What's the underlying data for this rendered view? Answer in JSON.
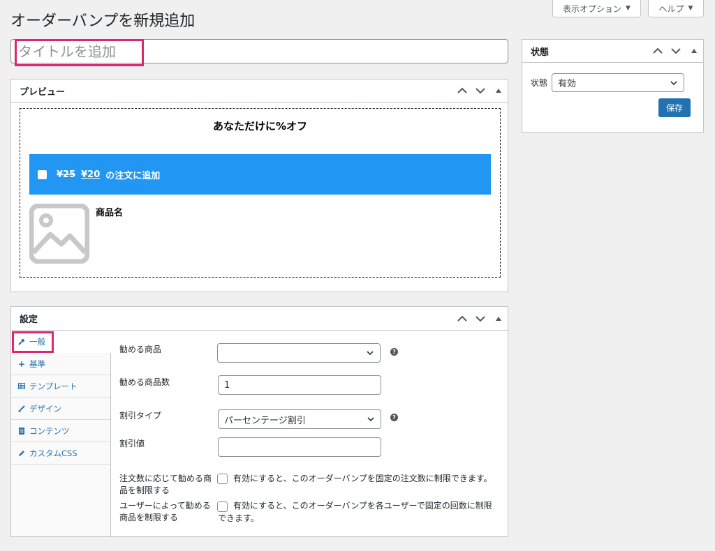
{
  "header": {
    "title": "オーダーバンプを新規追加",
    "screen_options_label": "表示オプション",
    "help_label": "ヘルプ"
  },
  "title_field": {
    "placeholder": "タイトルを追加",
    "value": ""
  },
  "status_box": {
    "title": "状態",
    "status_label": "状態",
    "status_value": "有効",
    "save_label": "保存"
  },
  "preview_box": {
    "title": "プレビュー",
    "headline": "あなただけに%オフ",
    "old_price": "¥25",
    "new_price": "¥20",
    "add_text": "の注文に追加",
    "product_name": "商品名",
    "bar_color": "#2196f3"
  },
  "settings_box": {
    "title": "設定",
    "tabs": [
      {
        "label": "一般",
        "icon": "wrench-icon"
      },
      {
        "label": "基準",
        "icon": "plus-icon"
      },
      {
        "label": "テンプレート",
        "icon": "table-icon"
      },
      {
        "label": "デザイン",
        "icon": "brush-icon"
      },
      {
        "label": "コンテンツ",
        "icon": "document-icon"
      },
      {
        "label": "カスタムCSS",
        "icon": "pencil-icon"
      }
    ],
    "fields": {
      "recommended_product_label": "勧める商品",
      "recommended_product_value": "",
      "recommended_qty_label": "勧める商品数",
      "recommended_qty_value": "1",
      "discount_type_label": "割引タイプ",
      "discount_type_value": "パーセンテージ割引",
      "discount_value_label": "割引値",
      "discount_value_value": "",
      "limit_order_label_1": "注文数に応じて勧める商",
      "limit_order_label_2": "品を制限する",
      "limit_order_desc": "有効にすると、このオーダーバンプを固定の注文数に制限できます。",
      "limit_user_label_1": "ユーザーによって勧める",
      "limit_user_label_2": "商品を制限する",
      "limit_user_desc_1": "有効にすると、このオーダーバンプを各ユーザーで固定の回数に制限",
      "limit_user_desc_2": "できます。"
    }
  },
  "accent_color": "#2271b1",
  "highlight_color": "#e1266e"
}
